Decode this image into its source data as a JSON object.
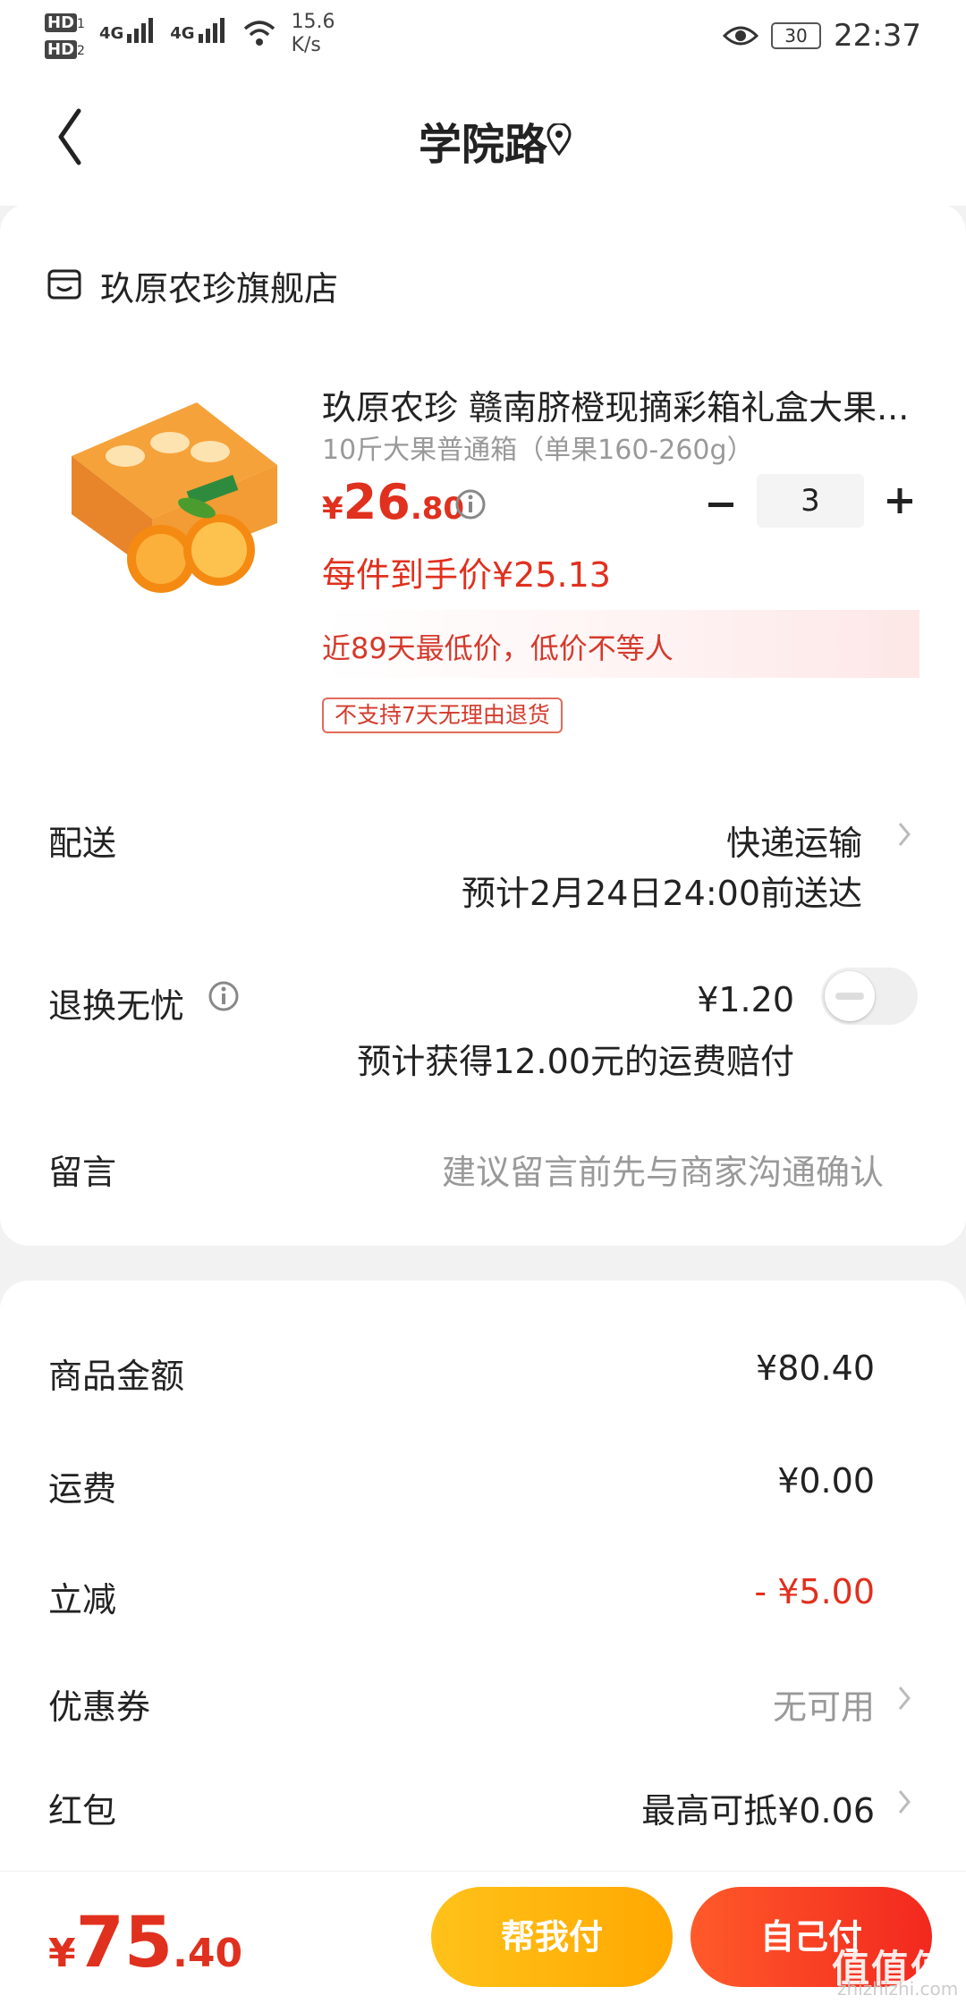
{
  "status_bar": {
    "sim1": "HD",
    "sim1_n": "1",
    "sim2": "HD",
    "sim2_n": "2",
    "net1": "4G",
    "net2": "4G",
    "speed_value": "15.6",
    "speed_unit": "K/s",
    "battery": "30",
    "time": "22:37"
  },
  "header": {
    "title": "学院路"
  },
  "shop": {
    "name": "玖原农珍旗舰店"
  },
  "product": {
    "title": "玖原农珍 赣南脐橙现摘彩箱礼盒大果...",
    "spec": "10斤大果普通箱（单果160-260g）",
    "price_symbol": "¥",
    "price_int": "26",
    "price_dec": ".80",
    "quantity": "3",
    "final_price_text": "每件到手价¥25.13",
    "lowest_text": "近89天最低价，低价不等人",
    "no_return_tag": "不支持7天无理由退货"
  },
  "delivery": {
    "label": "配送",
    "method": "快递运输",
    "eta": "预计2月24日24:00前送达"
  },
  "return_insurance": {
    "label": "退换无忧",
    "price": "¥1.20",
    "note": "预计获得12.00元的运费赔付",
    "enabled": false
  },
  "message": {
    "label": "留言",
    "placeholder": "建议留言前先与商家沟通确认"
  },
  "summary": {
    "goods_label": "商品金额",
    "goods_value": "¥80.40",
    "shipping_label": "运费",
    "shipping_value": "¥0.00",
    "discount_label": "立减",
    "discount_value": "- ¥5.00",
    "coupon_label": "优惠券",
    "coupon_value": "无可用",
    "redpacket_label": "红包",
    "redpacket_value": "最高可抵¥0.06"
  },
  "bottom": {
    "total_symbol": "¥",
    "total_int": "75",
    "total_dec": ".40",
    "help_pay_label": "帮我付",
    "self_pay_label": "自己付",
    "watermark": "值值值",
    "watermark_sub": "zhizhizhi.com"
  },
  "colors": {
    "accent_red": "#e0301e",
    "help_btn": "#ffb70f",
    "self_btn": "#f3311f"
  }
}
